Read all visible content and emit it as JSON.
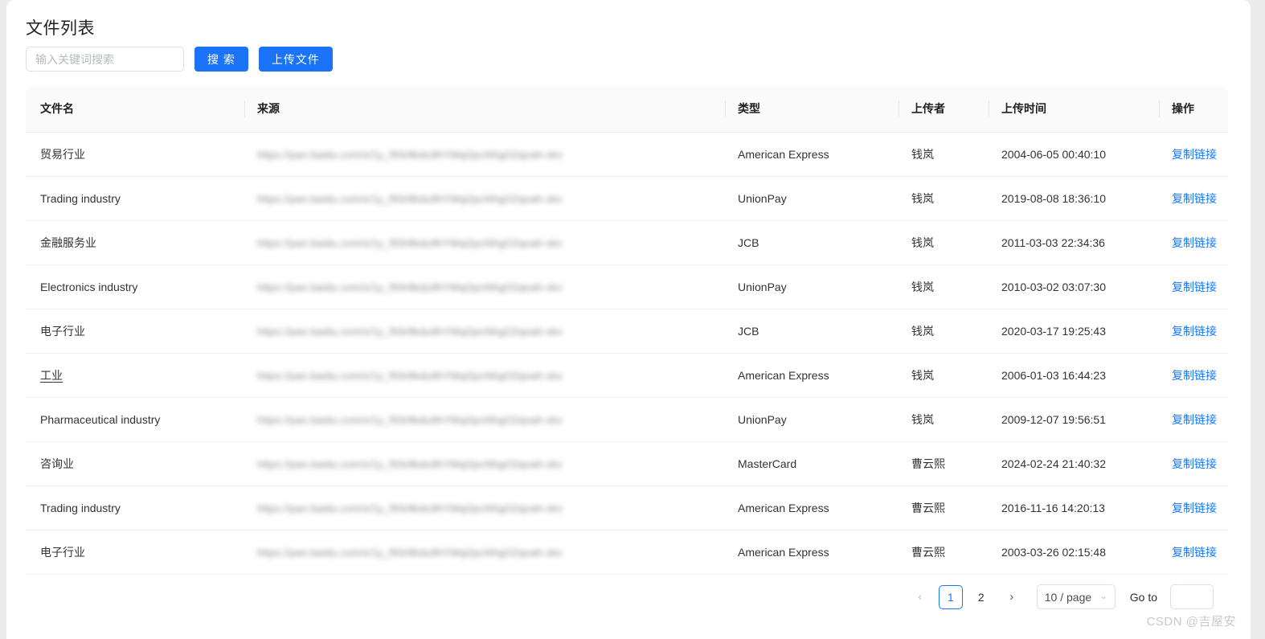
{
  "page": {
    "title": "文件列表",
    "watermark": "CSDN @吉屋安"
  },
  "toolbar": {
    "search_placeholder": "输入关键词搜索",
    "search_value": "",
    "search_button": "搜 索",
    "upload_button": "上传文件"
  },
  "table": {
    "columns": [
      {
        "key": "name",
        "label": "文件名"
      },
      {
        "key": "source",
        "label": "来源"
      },
      {
        "key": "type",
        "label": "类型"
      },
      {
        "key": "uploader",
        "label": "上传者"
      },
      {
        "key": "time",
        "label": "上传时间"
      },
      {
        "key": "action",
        "label": "操作"
      }
    ],
    "action_label": "复制链接",
    "rows": [
      {
        "name": "贸易行业",
        "name_linked": false,
        "source": "https://pan.baidu.com/s/1y_f93r8kdu9hYMqi2pcNhgO2qoah-skv",
        "type": "American Express",
        "uploader": "钱岚",
        "time": "2004-06-05 00:40:10"
      },
      {
        "name": "Trading industry",
        "name_linked": false,
        "source": "https://pan.baidu.com/s/1y_f93r8kdu9hYMqi2pcNhgO2qoah-skv",
        "type": "UnionPay",
        "uploader": "钱岚",
        "time": "2019-08-08 18:36:10"
      },
      {
        "name": "金融服务业",
        "name_linked": false,
        "source": "https://pan.baidu.com/s/1y_f93r8kdu9hYMqi2pcNhgO2qoah-skv",
        "type": "JCB",
        "uploader": "钱岚",
        "time": "2011-03-03 22:34:36"
      },
      {
        "name": "Electronics industry",
        "name_linked": false,
        "source": "https://pan.baidu.com/s/1y_f93r8kdu9hYMqi2pcNhgO2qoah-skv",
        "type": "UnionPay",
        "uploader": "钱岚",
        "time": "2010-03-02 03:07:30"
      },
      {
        "name": "电子行业",
        "name_linked": false,
        "source": "https://pan.baidu.com/s/1y_f93r8kdu9hYMqi2pcNhgO2qoah-skv",
        "type": "JCB",
        "uploader": "钱岚",
        "time": "2020-03-17 19:25:43"
      },
      {
        "name": "工业",
        "name_linked": true,
        "source": "https://pan.baidu.com/s/1y_f93r8kdu9hYMqi2pcNhgO2qoah-skv",
        "type": "American Express",
        "uploader": "钱岚",
        "time": "2006-01-03 16:44:23"
      },
      {
        "name": "Pharmaceutical industry",
        "name_linked": false,
        "source": "https://pan.baidu.com/s/1y_f93r8kdu9hYMqi2pcNhgO2qoah-skv",
        "type": "UnionPay",
        "uploader": "钱岚",
        "time": "2009-12-07 19:56:51"
      },
      {
        "name": "咨询业",
        "name_linked": false,
        "source": "https://pan.baidu.com/s/1y_f93r8kdu9hYMqi2pcNhgO2qoah-skv",
        "type": "MasterCard",
        "uploader": "曹云熙",
        "time": "2024-02-24 21:40:32"
      },
      {
        "name": "Trading industry",
        "name_linked": false,
        "source": "https://pan.baidu.com/s/1y_f93r8kdu9hYMqi2pcNhgO2qoah-skv",
        "type": "American Express",
        "uploader": "曹云熙",
        "time": "2016-11-16 14:20:13"
      },
      {
        "name": "电子行业",
        "name_linked": false,
        "source": "https://pan.baidu.com/s/1y_f93r8kdu9hYMqi2pcNhgO2qoah-skv",
        "type": "American Express",
        "uploader": "曹云熙",
        "time": "2003-03-26 02:15:48"
      }
    ]
  },
  "pagination": {
    "prev_glyph": "‹",
    "next_glyph": "›",
    "pages": [
      "1",
      "2"
    ],
    "current_page": "1",
    "page_size_label": "10 / page",
    "chevron_glyph": "⌄",
    "goto_label": "Go to",
    "goto_value": ""
  },
  "colors": {
    "primary": "#1a73f8",
    "link": "#1677ff",
    "header_bg": "#fafafa",
    "border": "#f0f0f0"
  }
}
